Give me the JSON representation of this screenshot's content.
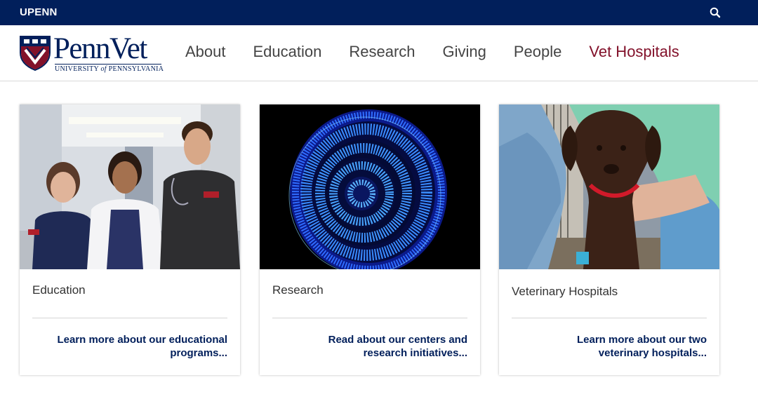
{
  "topbar": {
    "brand": "UPENN",
    "search_icon": "search-icon"
  },
  "logo": {
    "name": "PennVet",
    "subtitle_pre": "UNIVERSITY ",
    "subtitle_of": "of",
    "subtitle_post": " PENNSYLVANIA",
    "shield_icon": "penn-shield-icon"
  },
  "nav": {
    "items": [
      {
        "label": "About"
      },
      {
        "label": "Education"
      },
      {
        "label": "Research"
      },
      {
        "label": "Giving"
      },
      {
        "label": "People"
      },
      {
        "label": "Vet Hospitals"
      }
    ]
  },
  "cards": [
    {
      "title": "Education",
      "link": "Learn more about our educational programs...",
      "image": "students-photo"
    },
    {
      "title": "Research",
      "link": "Read about our centers and research initiatives...",
      "image": "spiral-tissue-microscopy"
    },
    {
      "title": "Veterinary Hospitals",
      "link": "Learn more about our two veterinary hospitals...",
      "image": "puppy-photo"
    }
  ],
  "colors": {
    "navy": "#011f5b",
    "penn_red": "#82112a"
  }
}
